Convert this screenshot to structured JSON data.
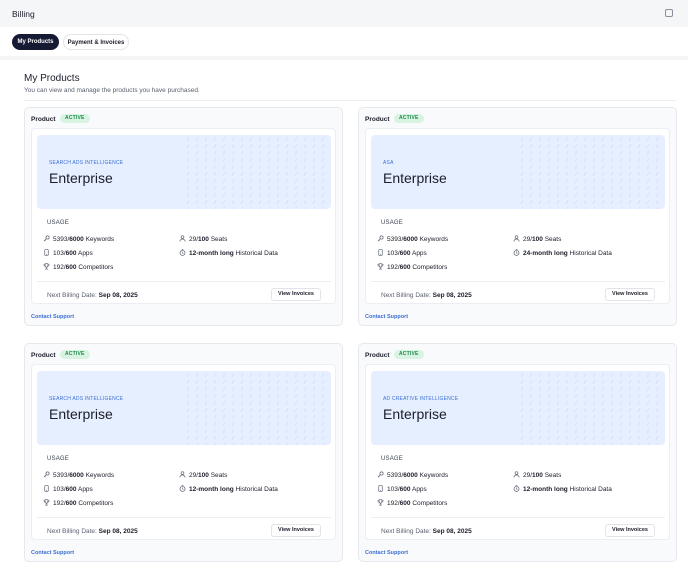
{
  "header": {
    "title": "Billing",
    "window_icon": "window-icon"
  },
  "tabs": [
    {
      "label": "My Products",
      "active": true
    },
    {
      "label": "Payment & Invoices",
      "active": false
    }
  ],
  "page": {
    "title": "My Products",
    "subtitle": "You can view and manage the products you have purchased."
  },
  "colors": {
    "accent": "#161b33",
    "active_badge": "#1f8a4c",
    "hero_bg": "#e6efff",
    "link": "#3b6fd6"
  },
  "common": {
    "product_label": "Product",
    "status": "ACTIVE",
    "usage_heading": "USAGE",
    "billing_label": "Next Billing Date:",
    "view_invoices": "View Invoices",
    "contact_support": "Contact Support",
    "sep": "/"
  },
  "cards": [
    {
      "eyebrow": "SEARCH ADS INTELLIGENCE",
      "plan": "Enterprise",
      "keywords": {
        "used": "5393",
        "total": "6000",
        "label": "Keywords"
      },
      "apps": {
        "used": "103",
        "total": "600",
        "label": "Apps"
      },
      "competitors": {
        "used": "192",
        "total": "600",
        "label": "Competitors"
      },
      "seats": {
        "used": "29",
        "total": "100",
        "label": "Seats"
      },
      "history": {
        "period": "12-month long",
        "label": "Historical Data"
      },
      "billing_date": "Sep 08, 2025"
    },
    {
      "eyebrow": "ASA",
      "plan": "Enterprise",
      "keywords": {
        "used": "5393",
        "total": "6000",
        "label": "Keywords"
      },
      "apps": {
        "used": "103",
        "total": "600",
        "label": "Apps"
      },
      "competitors": {
        "used": "192",
        "total": "600",
        "label": "Competitors"
      },
      "seats": {
        "used": "29",
        "total": "100",
        "label": "Seats"
      },
      "history": {
        "period": "24-month long",
        "label": "Historical Data"
      },
      "billing_date": "Sep 08, 2025"
    },
    {
      "eyebrow": "SEARCH ADS INTELLIGENCE",
      "plan": "Enterprise",
      "keywords": {
        "used": "5393",
        "total": "6000",
        "label": "Keywords"
      },
      "apps": {
        "used": "103",
        "total": "600",
        "label": "Apps"
      },
      "competitors": {
        "used": "192",
        "total": "600",
        "label": "Competitors"
      },
      "seats": {
        "used": "29",
        "total": "100",
        "label": "Seats"
      },
      "history": {
        "period": "12-month long",
        "label": "Historical Data"
      },
      "billing_date": "Sep 08, 2025"
    },
    {
      "eyebrow": "AD CREATIVE INTELLIGENCE",
      "plan": "Enterprise",
      "keywords": {
        "used": "5393",
        "total": "6000",
        "label": "Keywords"
      },
      "apps": {
        "used": "103",
        "total": "600",
        "label": "Apps"
      },
      "competitors": {
        "used": "192",
        "total": "600",
        "label": "Competitors"
      },
      "seats": {
        "used": "29",
        "total": "100",
        "label": "Seats"
      },
      "history": {
        "period": "12-month long",
        "label": "Historical Data"
      },
      "billing_date": "Sep 08, 2025"
    }
  ]
}
